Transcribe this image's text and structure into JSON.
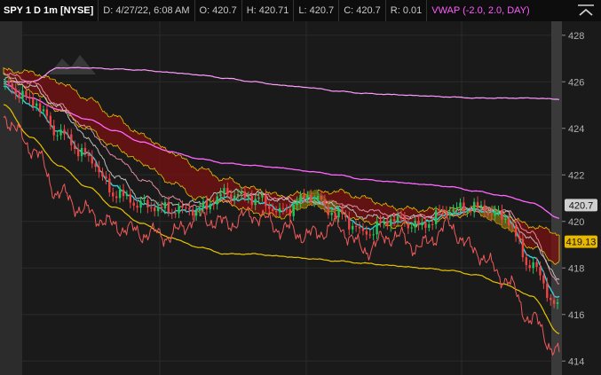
{
  "header": {
    "symbol": "SPY 1 D 1m [NYSE]",
    "date": "D: 4/27/22, 6:08 AM",
    "open": "O: 420.7",
    "high": "H: 420.71",
    "low": "L: 420.7",
    "close": "C: 420.7",
    "range": "R: 0.01",
    "vwap": "VWAP (-2.0, 2.0, DAY)"
  },
  "colors": {
    "background": "#1a1a1a",
    "price_up": "#22c55e",
    "price_down": "#ef4444",
    "vwap": "#ff66ff",
    "band_upper": "#ff9aff",
    "band_lower": "#e6c200",
    "cloud_bear": "#7a1010",
    "cloud_bull": "#6b6b10",
    "ma_cyan": "#35d0e0",
    "red_line": "#f05a5a",
    "pink_line": "#e08aa0",
    "grey_line": "#bdbdbd",
    "price_label": "#cfcfcf",
    "vwap_label": "#e6b800"
  },
  "icons": {
    "collapse": "collapse-chevron-icon",
    "watermark": "mountain-logo-icon"
  },
  "chart_data": {
    "type": "line",
    "yaxis": {
      "ticks": [
        428,
        426,
        424,
        422,
        420,
        418,
        416,
        414
      ],
      "ylim": [
        413.4,
        428.6
      ]
    },
    "price_label": "420.7",
    "vwap_label": "419.13",
    "price_label_value": 420.7,
    "vwap_label_value": 419.13,
    "x": [
      0,
      5,
      10,
      15,
      20,
      25,
      30,
      35,
      40,
      45,
      50,
      55,
      60,
      65,
      70,
      75,
      80,
      85,
      90,
      95,
      100
    ],
    "series": [
      {
        "key": "band_upper",
        "values": [
          426.0,
          426.0,
          426.6,
          426.6,
          426.55,
          426.5,
          426.4,
          426.3,
          426.15,
          426.0,
          425.85,
          425.75,
          425.6,
          425.5,
          425.45,
          425.4,
          425.35,
          425.3,
          425.3,
          425.3,
          425.25
        ]
      },
      {
        "key": "vwap",
        "values": [
          425.9,
          425.3,
          424.8,
          424.4,
          423.9,
          423.4,
          423.0,
          422.7,
          422.5,
          422.4,
          422.3,
          422.15,
          422.0,
          421.8,
          421.7,
          421.6,
          421.5,
          421.3,
          421.1,
          420.8,
          420.15
        ]
      },
      {
        "key": "band_lower",
        "values": [
          425.0,
          423.6,
          422.4,
          421.5,
          420.6,
          419.9,
          419.3,
          418.9,
          418.6,
          418.6,
          418.5,
          418.4,
          418.3,
          418.2,
          418.1,
          418.0,
          417.9,
          417.7,
          417.3,
          416.8,
          415.2
        ]
      },
      {
        "key": "cloud_top",
        "values": [
          426.5,
          426.4,
          426.0,
          425.3,
          424.5,
          423.7,
          423.0,
          422.3,
          421.8,
          421.4,
          421.1,
          421.2,
          421.3,
          421.0,
          420.6,
          420.5,
          420.5,
          420.6,
          420.3,
          419.8,
          419.5
        ]
      },
      {
        "key": "cloud_bottom",
        "values": [
          426.3,
          425.6,
          424.8,
          424.0,
          423.2,
          422.5,
          421.7,
          421.0,
          420.8,
          420.4,
          420.2,
          420.7,
          420.4,
          420.0,
          419.8,
          419.9,
          420.2,
          420.4,
          419.8,
          418.9,
          418.2
        ]
      },
      {
        "key": "price",
        "values": [
          425.9,
          425.2,
          423.8,
          422.8,
          421.2,
          420.7,
          420.5,
          420.5,
          421.2,
          421.0,
          420.4,
          421.1,
          420.3,
          419.5,
          420.1,
          419.8,
          420.5,
          420.6,
          420.2,
          418.1,
          416.2
        ]
      },
      {
        "key": "ma_cyan",
        "values": [
          425.8,
          425.0,
          423.9,
          422.9,
          421.5,
          420.8,
          420.4,
          420.5,
          421.0,
          420.9,
          420.5,
          421.0,
          420.5,
          419.7,
          420.0,
          419.9,
          420.3,
          420.5,
          420.3,
          418.5,
          416.7
        ]
      },
      {
        "key": "grey_line",
        "values": [
          426.2,
          425.8,
          424.9,
          423.6,
          422.0,
          421.0,
          420.7,
          420.8,
          421.3,
          421.2,
          420.9,
          420.9,
          420.7,
          420.2,
          420.2,
          420.2,
          420.4,
          420.6,
          420.4,
          419.2,
          417.5
        ]
      },
      {
        "key": "pink_line",
        "values": [
          426.4,
          426.0,
          425.0,
          424.0,
          422.8,
          421.8,
          421.0,
          420.6,
          420.9,
          421.2,
          421.0,
          420.8,
          420.8,
          420.5,
          420.3,
          420.2,
          420.3,
          420.5,
          420.5,
          419.5,
          417.3
        ]
      },
      {
        "key": "red_line",
        "values": [
          424.5,
          423.2,
          421.2,
          420.4,
          419.8,
          419.5,
          419.4,
          420.2,
          419.9,
          420.3,
          419.7,
          419.4,
          419.8,
          418.8,
          419.4,
          418.9,
          419.8,
          418.7,
          417.6,
          415.8,
          414.3
        ]
      }
    ]
  }
}
